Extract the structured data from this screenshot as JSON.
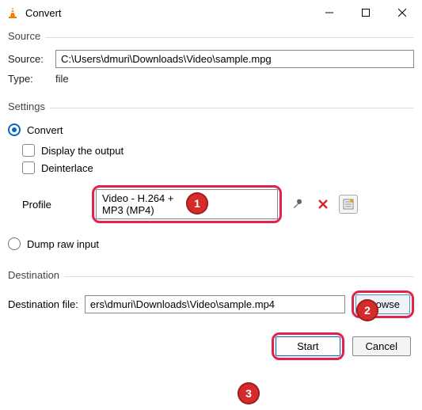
{
  "window": {
    "title": "Convert"
  },
  "source": {
    "legend": "Source",
    "source_label": "Source:",
    "source_value": "C:\\Users\\dmuri\\Downloads\\Video\\sample.mpg",
    "type_label": "Type:",
    "type_value": "file"
  },
  "settings": {
    "legend": "Settings",
    "convert_label": "Convert",
    "display_output_label": "Display the output",
    "deinterlace_label": "Deinterlace",
    "profile_label": "Profile",
    "profile_value": "Video - H.264 + MP3 (MP4)",
    "dump_raw_label": "Dump raw input"
  },
  "destination": {
    "legend": "Destination",
    "dest_file_label": "Destination file:",
    "dest_file_value": "ers\\dmuri\\Downloads\\Video\\sample.mp4",
    "browse_label": "Browse"
  },
  "buttons": {
    "start_label": "Start",
    "cancel_label": "Cancel"
  },
  "callouts": {
    "1": "1",
    "2": "2",
    "3": "3"
  }
}
